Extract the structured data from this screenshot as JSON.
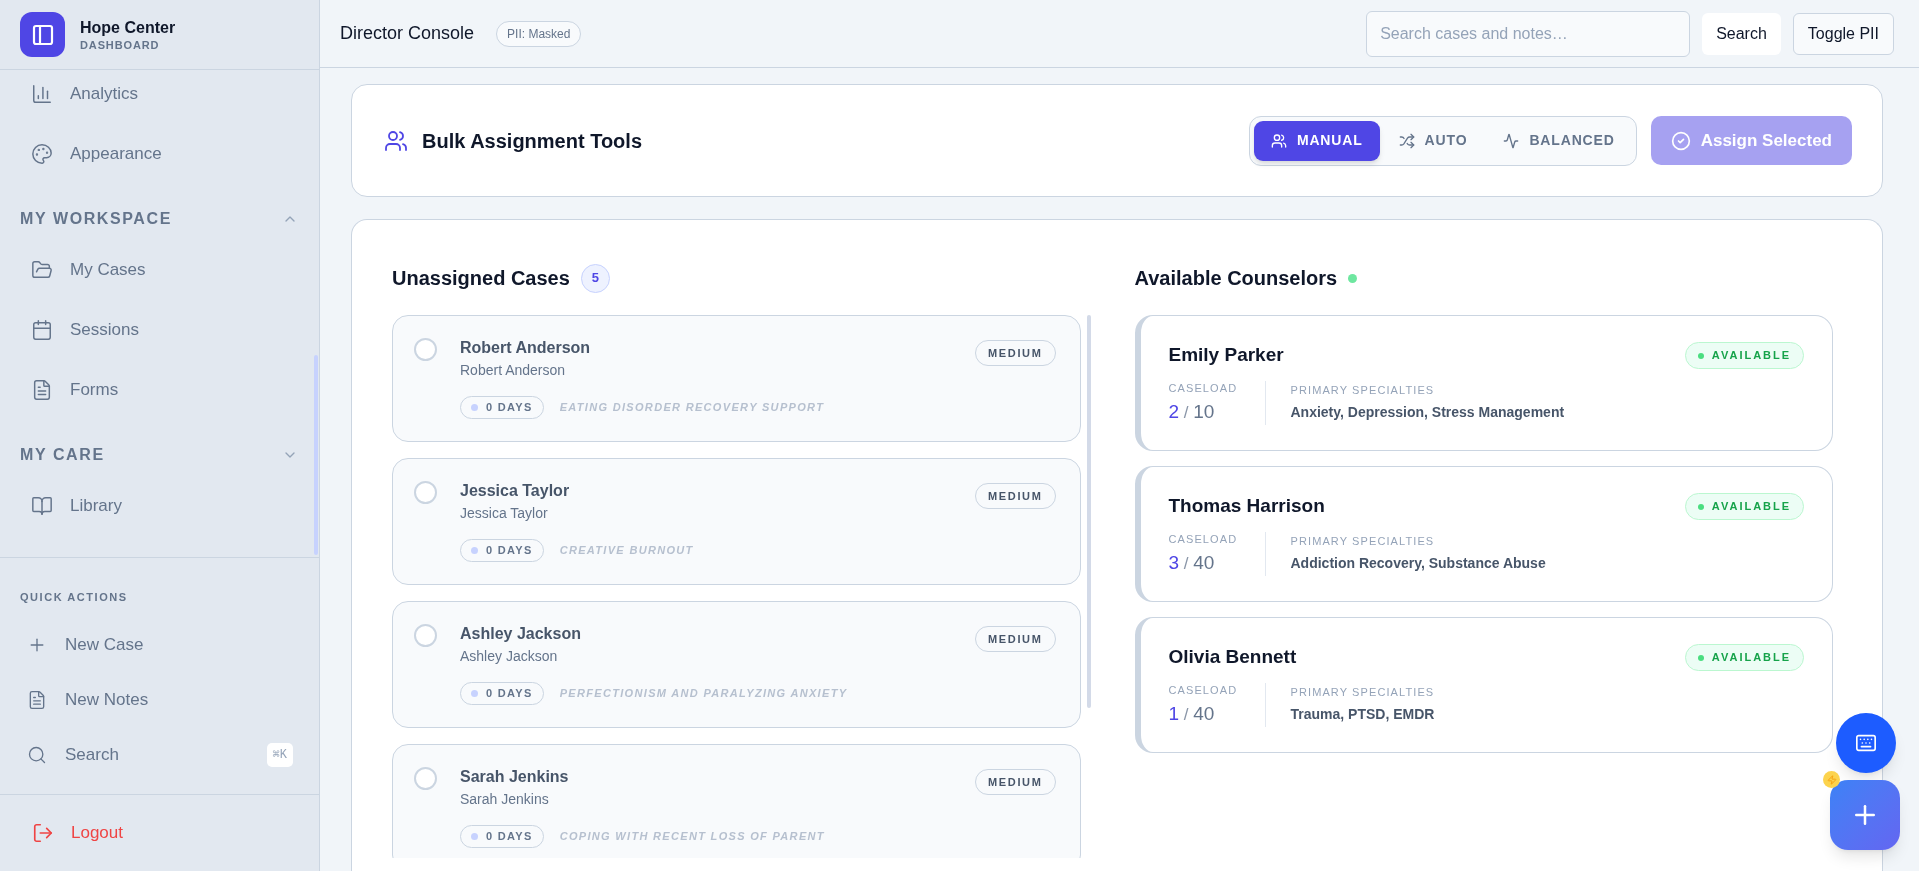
{
  "sidebar": {
    "brand": {
      "name": "Hope Center",
      "subtitle": "DASHBOARD"
    },
    "nav_sections": [
      {
        "items": [
          {
            "label": "Analytics",
            "selected": false
          },
          {
            "label": "Appearance",
            "selected": false
          }
        ]
      },
      {
        "title": "MY WORKSPACE",
        "expanded": true,
        "items": [
          {
            "label": "My Cases",
            "selected": false
          },
          {
            "label": "Sessions",
            "selected": false
          },
          {
            "label": "Forms",
            "selected": false
          }
        ]
      },
      {
        "title": "MY CARE",
        "expanded": false,
        "items": [
          {
            "label": "Library",
            "selected": false
          }
        ]
      }
    ],
    "quick_actions": {
      "title": "QUICK ACTIONS",
      "items": [
        {
          "label": "New Case"
        },
        {
          "label": "New Notes"
        },
        {
          "label": "Search",
          "shortcut": "⌘K"
        }
      ]
    },
    "logout": {
      "label": "Logout"
    }
  },
  "header": {
    "title": "Director Console",
    "pii_badge": "PII: Masked",
    "search": {
      "placeholder": "Search cases and notes…"
    },
    "buttons": [
      "Search",
      "Toggle PII"
    ]
  },
  "bulk_tools": {
    "title": "Bulk Assignment Tools",
    "modes": [
      {
        "label": "MANUAL",
        "selected": true
      },
      {
        "label": "AUTO",
        "selected": false
      },
      {
        "label": "BALANCED",
        "selected": false
      }
    ],
    "assign_button": {
      "label": "Assign Selected",
      "disabled": true
    }
  },
  "unassigned_cases": {
    "title": "Unassigned Cases",
    "count": "5",
    "cases": [
      {
        "name": "Robert Anderson",
        "client": "Robert Anderson",
        "days": "0 DAYS",
        "topic": "EATING DISORDER RECOVERY SUPPORT",
        "priority": "MEDIUM",
        "selected": false
      },
      {
        "name": "Jessica Taylor",
        "client": "Jessica Taylor",
        "days": "0 DAYS",
        "topic": "CREATIVE BURNOUT",
        "priority": "MEDIUM",
        "selected": false
      },
      {
        "name": "Ashley Jackson",
        "client": "Ashley Jackson",
        "days": "0 DAYS",
        "topic": "PERFECTIONISM AND PARALYZING ANXIETY",
        "priority": "MEDIUM",
        "selected": false
      },
      {
        "name": "Sarah Jenkins",
        "client": "Sarah Jenkins",
        "days": "0 DAYS",
        "topic": "COPING WITH RECENT LOSS OF PARENT",
        "priority": "MEDIUM",
        "selected": false
      }
    ]
  },
  "counselors": {
    "title": "Available Counselors",
    "items": [
      {
        "name": "Emily Parker",
        "status": "AVAILABLE",
        "caseload_label": "CASELOAD",
        "caseload": {
          "current": "2",
          "separator": "/",
          "max": "10"
        },
        "specialties_label": "PRIMARY SPECIALTIES",
        "specialties": "Anxiety, Depression, Stress Management"
      },
      {
        "name": "Thomas Harrison",
        "status": "AVAILABLE",
        "caseload_label": "CASELOAD",
        "caseload": {
          "current": "3",
          "separator": "/",
          "max": "40"
        },
        "specialties_label": "PRIMARY SPECIALTIES",
        "specialties": "Addiction Recovery, Substance Abuse"
      },
      {
        "name": "Olivia Bennett",
        "status": "AVAILABLE",
        "caseload_label": "CASELOAD",
        "caseload": {
          "current": "1",
          "separator": "/",
          "max": "40"
        },
        "specialties_label": "PRIMARY SPECIALTIES",
        "specialties": "Trauma, PTSD, EMDR"
      }
    ]
  }
}
